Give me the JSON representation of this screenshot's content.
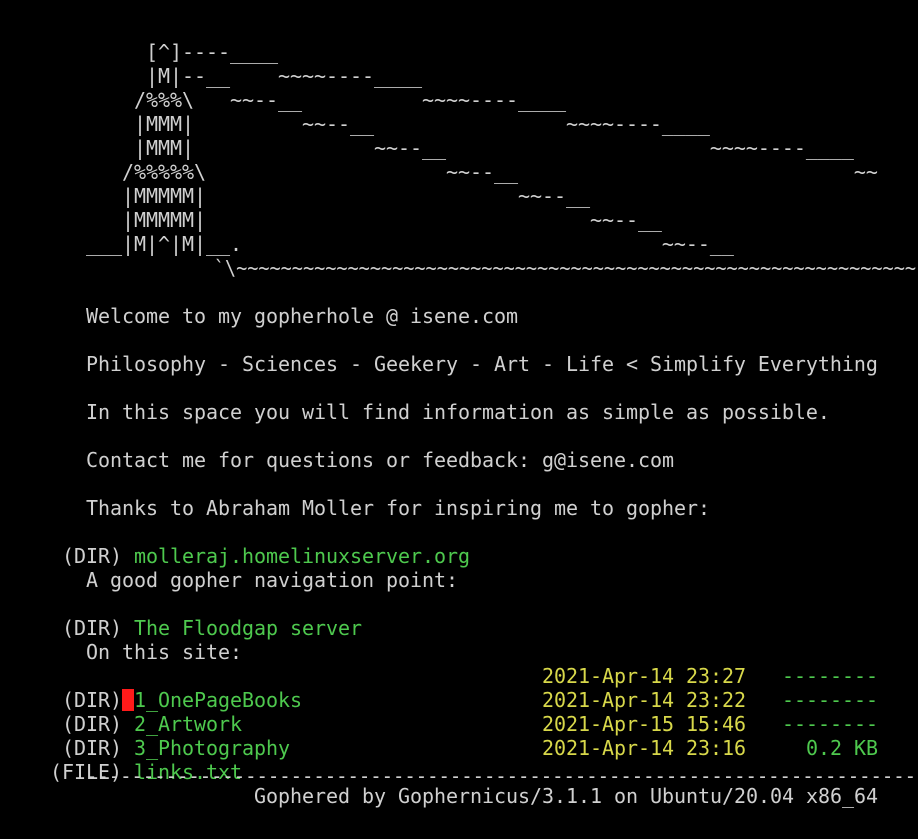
{
  "ascii_art": [
    "            [^]----____",
    "            |M|--__    ~~~~----____",
    "           /%%%\\   ~~--__          ~~~~----____",
    "           |MMM|         ~~--__                ~~~~----____",
    "           |MMM|               ~~--__                      ~~~~----____",
    "          /%%%%%\\                    ~~--__                            ~~",
    "          |MMMMM|                          ~~--__",
    "          |MMMMM|                                ~~--__",
    "       ___|M|^|M|__.                                   ~~--__",
    "                   `\\~~~~~~~~~~~~~~~~~~~~~~~~~~~~~~~~~~~~~~~~~~~~~~~~~~~~~~~~~~~~~"
  ],
  "info": {
    "welcome": "Welcome to my gopherhole @ isene.com",
    "tagline": "Philosophy - Sciences - Geekery - Art - Life < Simplify Everything",
    "intro": "In this space you will find information as simple as possible.",
    "contact": "Contact me for questions or feedback: g@isene.com",
    "thanks": "Thanks to Abraham Moller for inspiring me to gopher:",
    "nav_point": "A good gopher navigation point:",
    "on_site": "On this site:"
  },
  "links": {
    "moller": {
      "type": " (DIR) ",
      "label": "molleraj.homelinuxserver.org"
    },
    "floodgap": {
      "type": " (DIR) ",
      "label": "The Floodgap server"
    }
  },
  "site_items": [
    {
      "type": " (DIR)",
      "name": "1_OnePageBooks",
      "date": "2021-Apr-14 23:27",
      "size": "--------",
      "selected": true
    },
    {
      "type": " (DIR) ",
      "name": "2_Artwork",
      "date": "2021-Apr-14 23:22",
      "size": "--------",
      "selected": false
    },
    {
      "type": " (DIR) ",
      "name": "3_Photography",
      "date": "2021-Apr-15 15:46",
      "size": "--------",
      "selected": false
    },
    {
      "type": "(FILE) ",
      "name": "links.txt",
      "date": "2021-Apr-14 23:16",
      "size": "0.2 KB",
      "selected": false
    }
  ],
  "footer": {
    "separator": "-------------------------------------------------------------------------",
    "credit": "Gophered by Gophernicus/3.1.1 on Ubuntu/20.04 x86_64"
  },
  "colors": {
    "background": "#000000",
    "text": "#d0d0d0",
    "link": "#4ec94e",
    "date": "#d8d84a",
    "cursor": "#ff1a1a"
  }
}
